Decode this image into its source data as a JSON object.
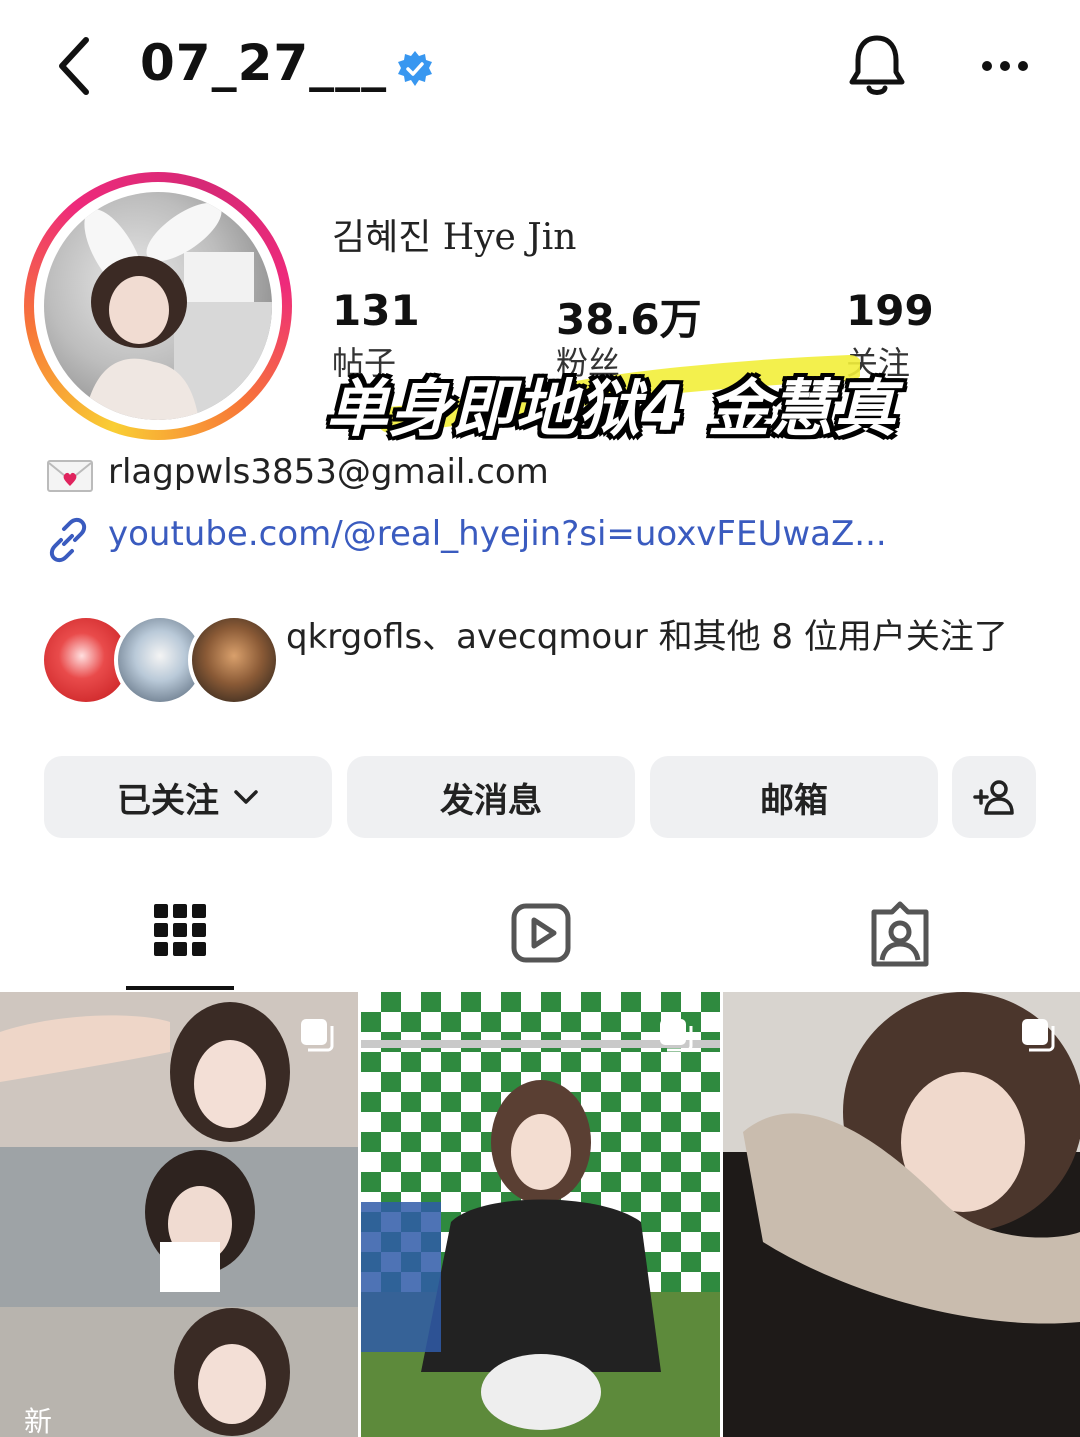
{
  "header": {
    "username": "07_27___",
    "verified": true
  },
  "profile": {
    "full_name": "김혜진 Hye Jin",
    "stats": {
      "posts": {
        "value": "131",
        "label": "帖子"
      },
      "followers": {
        "value": "38.6万",
        "label": "粉丝"
      },
      "following": {
        "value": "199",
        "label": "关注"
      }
    },
    "email": "rlagpwls3853@gmail.com",
    "link": "youtube.com/@real_hyejin?si=uoxvFEUwaZ...",
    "followed_by": "qkrgofls、avecqmour 和其他 8 位用户关注了"
  },
  "overlay_caption": "单身即地狱4 金慧真",
  "buttons": {
    "following": "已关注",
    "message": "发消息",
    "mailbox": "邮箱"
  },
  "grid": {
    "new_badge": "新"
  },
  "colors": {
    "verified_blue": "#3897f0",
    "link_blue": "#3a5bbf",
    "button_bg": "#eff0f2",
    "highlight_yellow": "#f2ee3a"
  },
  "icons": {
    "back": "chevron-left-icon",
    "bell": "bell-icon",
    "more": "more-horizontal-icon",
    "grid": "grid-icon",
    "reels": "reels-icon",
    "tagged": "tagged-icon",
    "add_user": "add-user-icon",
    "mail": "love-letter-icon",
    "link": "link-icon"
  }
}
